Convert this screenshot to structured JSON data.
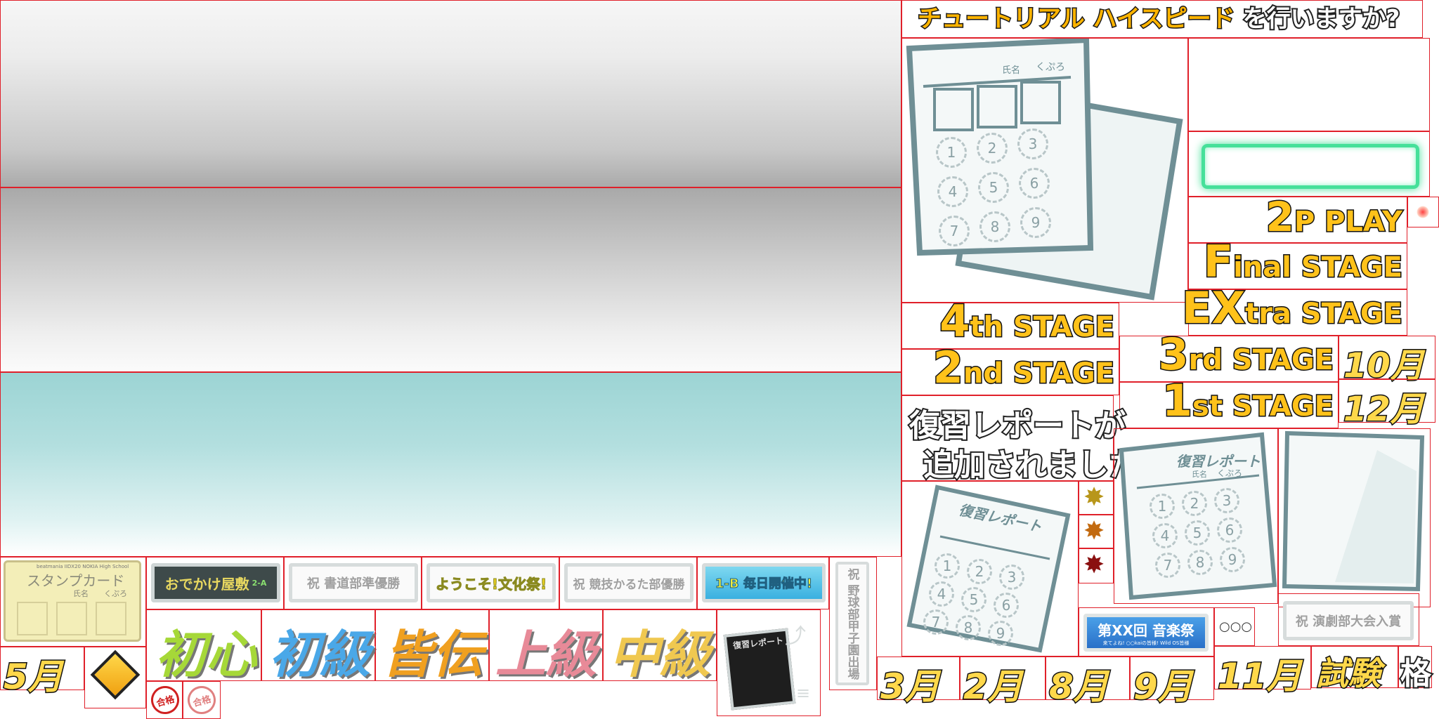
{
  "tutorial_prompt": {
    "highlight": "チュートリアル ハイスピード",
    "rest": "を行いますか?"
  },
  "stage_labels": {
    "p2_play": {
      "big": "2",
      "small": "P PLAY"
    },
    "final": {
      "big": "F",
      "small": "inal STAGE"
    },
    "extra": {
      "big": "EX",
      "small": "tra STAGE"
    },
    "fourth": {
      "big": "4",
      "small": "th STAGE"
    },
    "second": {
      "big": "2",
      "small": "nd STAGE"
    },
    "third": {
      "big": "3",
      "small": "rd STAGE"
    },
    "first": {
      "big": "1",
      "small": "st STAGE"
    }
  },
  "review_notice": {
    "line1": "復習レポートが",
    "line2": "追加されました!"
  },
  "stamp_card": {
    "header": "beatmania IIDX20 NOKIA High School",
    "title": "スタンプカード",
    "name_label": "氏名",
    "name_value": "くぷろ"
  },
  "report_card": {
    "title": "復習レポート",
    "name_label": "氏名",
    "name_value": "くぷろ",
    "numbers": [
      "1",
      "2",
      "3",
      "4",
      "5",
      "6",
      "7",
      "8",
      "9"
    ]
  },
  "banners": {
    "oden": "おでかけ屋敷",
    "oden_class": "2-A",
    "shodo": "祝 書道部準優勝",
    "welcome": "ようこそ!文化祭!",
    "karuta": "祝 競技かるた部優勝",
    "class_1b": "1-B 毎日開催中!",
    "baseball": "祝 野球部甲子園出場",
    "music": "第XX回 音楽祭",
    "music_sub": "来てよね! ○○kaiの皆様! Wild OS皆様",
    "drama": "祝 演劇部大会入賞",
    "dots": "○○○"
  },
  "ranks": [
    "初心",
    "初級",
    "皆伝",
    "上級",
    "中級"
  ],
  "months": {
    "may": "5月",
    "oct": "10月",
    "dec": "12月",
    "mar": "3月",
    "feb": "2月",
    "aug": "8月",
    "sep": "9月",
    "nov": "11月"
  },
  "exam": "試験",
  "pass_char": "格",
  "stamp_text": "合格",
  "colors": {
    "gold": "#ffc21a",
    "outline": "#111111",
    "grid": "#e0202a",
    "teal": "#9cd4d4",
    "green_frame": "#46e09a"
  }
}
